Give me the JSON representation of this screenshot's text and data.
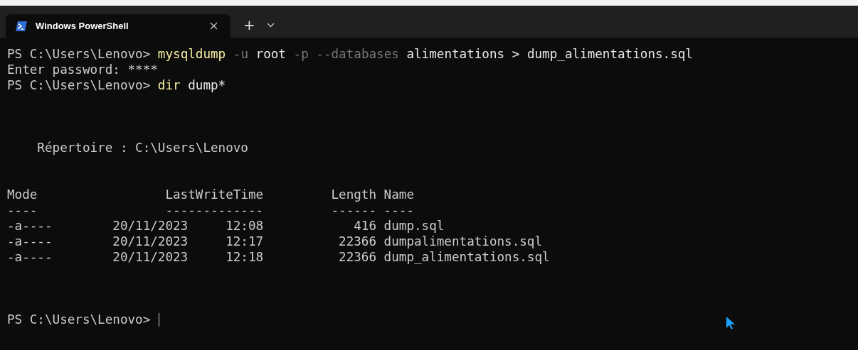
{
  "tabs": [
    {
      "title": "Windows PowerShell",
      "selected": true
    }
  ],
  "new_tab": "+",
  "lines": [
    {
      "kind": "text",
      "cursor": false,
      "segments": [
        {
          "kind": "prompt",
          "text": "PS C:\\Users\\Lenovo> "
        },
        {
          "kind": "command",
          "text": "mysqldump"
        },
        {
          "kind": "parameter",
          "text": " -u"
        },
        {
          "kind": "argument",
          "text": " root"
        },
        {
          "kind": "parameter",
          "text": " -p --databases"
        },
        {
          "kind": "argument",
          "text": " alimentations > dump_alimentations.sql"
        }
      ]
    },
    {
      "kind": "text",
      "cursor": false,
      "segments": [
        {
          "kind": "output",
          "text": "Enter password: ****"
        }
      ]
    },
    {
      "kind": "text",
      "cursor": false,
      "segments": [
        {
          "kind": "prompt",
          "text": "PS C:\\Users\\Lenovo> "
        },
        {
          "kind": "command",
          "text": "dir"
        },
        {
          "kind": "argument",
          "text": " dump*"
        }
      ]
    },
    {
      "kind": "blank",
      "cursor": false
    },
    {
      "kind": "blank",
      "cursor": false
    },
    {
      "kind": "blank",
      "cursor": false
    },
    {
      "kind": "text",
      "cursor": false,
      "segments": [
        {
          "kind": "output",
          "text": "    Répertoire : C:\\Users\\Lenovo"
        }
      ]
    },
    {
      "kind": "blank",
      "cursor": false
    },
    {
      "kind": "blank",
      "cursor": false
    },
    {
      "kind": "text",
      "cursor": false,
      "segments": [
        {
          "kind": "output",
          "text": "Mode                 LastWriteTime         Length Name"
        }
      ]
    },
    {
      "kind": "text",
      "cursor": false,
      "segments": [
        {
          "kind": "output",
          "text": "----                 -------------         ------ ----"
        }
      ]
    },
    {
      "kind": "text",
      "cursor": false,
      "segments": [
        {
          "kind": "output",
          "text": "-a----        20/11/2023     12:08            416 dump.sql"
        }
      ]
    },
    {
      "kind": "text",
      "cursor": false,
      "segments": [
        {
          "kind": "output",
          "text": "-a----        20/11/2023     12:17          22366 dumpalimentations.sql"
        }
      ]
    },
    {
      "kind": "text",
      "cursor": false,
      "segments": [
        {
          "kind": "output",
          "text": "-a----        20/11/2023     12:18          22366 dump_alimentations.sql"
        }
      ]
    },
    {
      "kind": "blank",
      "cursor": false
    },
    {
      "kind": "blank",
      "cursor": false
    },
    {
      "kind": "blank",
      "cursor": false
    },
    {
      "kind": "text",
      "cursor": true,
      "segments": [
        {
          "kind": "prompt",
          "text": "PS C:\\Users\\Lenovo> "
        }
      ]
    }
  ]
}
